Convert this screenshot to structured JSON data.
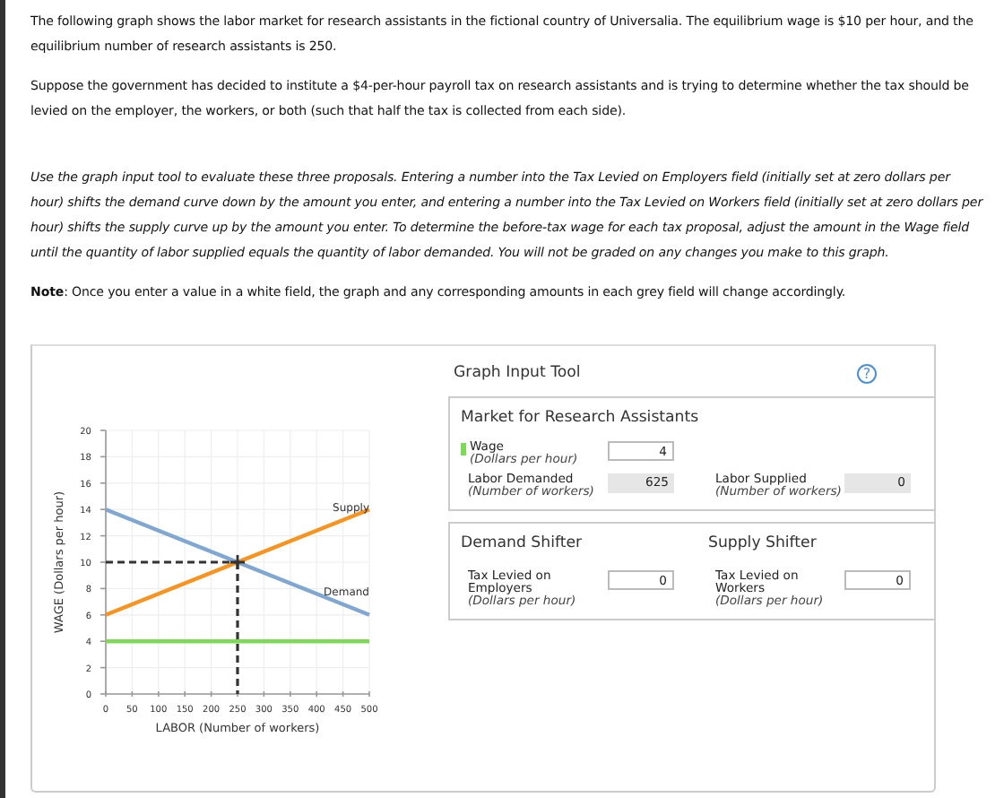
{
  "intro": [
    "The following graph shows the labor market for research assistants in the fictional country of Universalia. The equilibrium wage is $10 per hour, and the equilibrium number of research assistants is 250.",
    "Suppose the government has decided to institute a $4-per-hour payroll tax on research assistants and is trying to determine whether the tax should be levied on the employer, the workers, or both (such that half the tax is collected from each side)."
  ],
  "instructions": "Use the graph input tool to evaluate these three proposals. Entering a number into the Tax Levied on Employers field (initially set at zero dollars per hour) shifts the demand curve down by the amount you enter, and entering a number into the Tax Levied on Workers field (initially set at zero dollars per hour) shifts the supply curve up by the amount you enter. To determine the before-tax wage for each tax proposal, adjust the amount in the Wage field until the quantity of labor supplied equals the quantity of labor demanded. You will not be graded on any changes you make to this graph.",
  "note": "**Note**: Once you enter a value in a white field, the graph and any corresponding amounts in each grey field will change accordingly.",
  "chart_data": {
    "type": "line",
    "xlabel": "LABOR (Number of workers)",
    "ylabel": "WAGE (Dollars per hour)",
    "x": [
      0,
      500
    ],
    "xlim": [
      0,
      500
    ],
    "ylim": [
      0,
      20
    ],
    "xticks": [
      0,
      50,
      100,
      150,
      200,
      250,
      300,
      350,
      400,
      450,
      500
    ],
    "yticks": [
      0,
      2,
      4,
      6,
      8,
      10,
      12,
      14,
      16,
      18,
      20
    ],
    "series": [
      {
        "name": "Supply",
        "color": "#f7931e",
        "values": [
          6,
          14
        ]
      },
      {
        "name": "Demand",
        "color": "#7fa7d1",
        "values": [
          14,
          6
        ]
      },
      {
        "color": "#7ed957",
        "values": [
          4,
          4
        ]
      }
    ],
    "grid": true,
    "ref_lines": [
      {
        "axis": "y",
        "value": 10
      },
      {
        "axis": "x",
        "value": 250
      }
    ]
  },
  "tool": {
    "title": "Graph Input Tool",
    "help": "?",
    "market": {
      "title": "Market for Research Assistants",
      "fields": [
        {
          "label": "Wage",
          "unit": "(Dollars per hour)",
          "value": "4",
          "kind": "input",
          "color": "#7ed957"
        },
        {
          "label": "Labor Demanded",
          "unit": "(Number of workers)",
          "value": "625",
          "kind": "readout"
        },
        {
          "label": "Labor Supplied",
          "unit": "(Number of workers)",
          "value": "0",
          "kind": "readout"
        }
      ]
    },
    "shifters": [
      {
        "title": "Demand Shifter",
        "label": "Tax Levied on Employers",
        "unit": "(Dollars per hour)",
        "value": "0"
      },
      {
        "title": "Supply Shifter",
        "label": "Tax Levied on Workers",
        "unit": "(Dollars per hour)",
        "value": "0"
      }
    ]
  }
}
